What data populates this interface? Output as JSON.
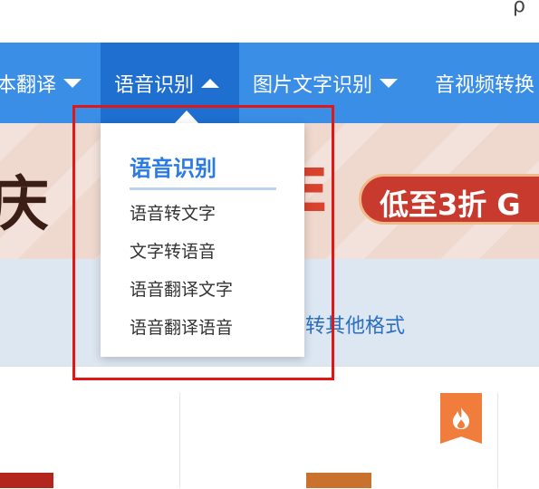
{
  "nav": {
    "items": [
      {
        "label": "本翻译",
        "state": "collapsed"
      },
      {
        "label": "语音识别",
        "state": "expanded"
      },
      {
        "label": "图片文字识别",
        "state": "collapsed"
      },
      {
        "label": "音视频转换",
        "state": "collapsed"
      }
    ]
  },
  "banner": {
    "text_left": "庆",
    "text_right": "E",
    "promo": "低至3折 G"
  },
  "subbar": {
    "text": "转其他格式"
  },
  "dropdown": {
    "title": "语音识别",
    "items": [
      "语音转文字",
      "文字转语音",
      "语音翻译文字",
      "语音翻译语音"
    ]
  },
  "icons": {
    "top_right": "partial-glyph-icon",
    "card_badge": "fire-icon"
  },
  "colors": {
    "nav_bg": "#3a8ee6",
    "nav_active_bg": "#1e6fd0",
    "dropdown_title": "#2c7be5",
    "highlight_border": "#e01717"
  }
}
